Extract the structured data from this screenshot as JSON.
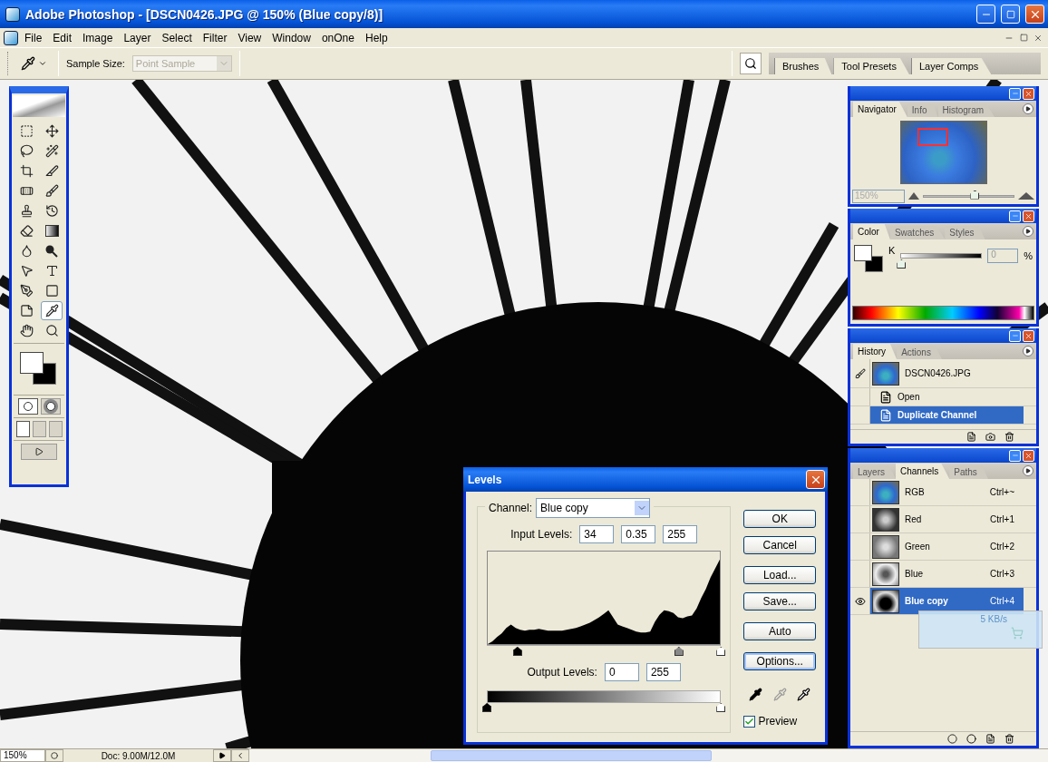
{
  "window": {
    "title": "Adobe Photoshop - [DSCN0426.JPG @ 150% (Blue copy/8)]"
  },
  "menu": [
    "File",
    "Edit",
    "Image",
    "Layer",
    "Select",
    "Filter",
    "View",
    "Window",
    "onOne",
    "Help"
  ],
  "options_bar": {
    "sample_size_label": "Sample Size:",
    "sample_size": {
      "value": "Point Sample",
      "disabled": true
    }
  },
  "palette_well_tabs": [
    "Brushes",
    "Tool Presets",
    "Layer Comps"
  ],
  "toolbox": {
    "tools": [
      {
        "kind": "marquee",
        "selected": false
      },
      {
        "kind": "move",
        "selected": false
      },
      {
        "kind": "lasso",
        "selected": false
      },
      {
        "kind": "wand",
        "selected": false
      },
      {
        "kind": "crop",
        "selected": false
      },
      {
        "kind": "slice",
        "selected": false
      },
      {
        "kind": "healing",
        "selected": false
      },
      {
        "kind": "brush",
        "selected": false
      },
      {
        "kind": "stamp",
        "selected": false
      },
      {
        "kind": "history",
        "selected": false
      },
      {
        "kind": "eraser",
        "selected": false
      },
      {
        "kind": "gradient",
        "selected": false
      },
      {
        "kind": "blur",
        "selected": false
      },
      {
        "kind": "dodge",
        "selected": false
      },
      {
        "kind": "path",
        "selected": false
      },
      {
        "kind": "type",
        "selected": false
      },
      {
        "kind": "pen",
        "selected": false
      },
      {
        "kind": "shape",
        "selected": false
      },
      {
        "kind": "notes",
        "selected": false
      },
      {
        "kind": "eyedropper",
        "selected": true
      },
      {
        "kind": "hand",
        "selected": false
      },
      {
        "kind": "zoom",
        "selected": false
      }
    ],
    "mask_modes": [
      {
        "selected": true
      },
      {
        "selected": false
      }
    ],
    "screen_modes": [
      {
        "selected": true
      },
      {
        "selected": false
      },
      {
        "selected": false
      }
    ]
  },
  "navigator": {
    "tabs": [
      {
        "label": "Navigator",
        "selected": true
      },
      {
        "label": "Info",
        "selected": false
      },
      {
        "label": "Histogram",
        "selected": false
      }
    ],
    "zoom": "150%",
    "zoom_slider": {
      "level": 0.57
    }
  },
  "color": {
    "tabs": [
      {
        "label": "Color",
        "selected": true
      },
      {
        "label": "Swatches",
        "selected": false
      },
      {
        "label": "Styles",
        "selected": false
      }
    ],
    "channel": "K",
    "slider": {
      "level": 0
    },
    "value": "0",
    "unit": "%"
  },
  "history": {
    "tabs": [
      {
        "label": "History",
        "selected": true
      },
      {
        "label": "Actions",
        "selected": false
      }
    ],
    "items": [
      {
        "kind": "snapshot",
        "label": "DSCN0426.JPG",
        "selected": false
      },
      {
        "kind": "step",
        "label": "Open",
        "selected": false
      },
      {
        "kind": "step",
        "label": "Duplicate Channel",
        "selected": true
      }
    ]
  },
  "channels": {
    "tabs": [
      {
        "label": "Layers",
        "selected": false
      },
      {
        "label": "Channels",
        "selected": true
      },
      {
        "label": "Paths",
        "selected": false
      }
    ],
    "rows": [
      {
        "name": "RGB",
        "shortcut": "Ctrl+~",
        "kind": "color",
        "visible": false,
        "selected": false
      },
      {
        "name": "Red",
        "shortcut": "Ctrl+1",
        "kind": "dark",
        "visible": false,
        "selected": false
      },
      {
        "name": "Green",
        "shortcut": "Ctrl+2",
        "kind": "mid",
        "visible": false,
        "selected": false
      },
      {
        "name": "Blue",
        "shortcut": "Ctrl+3",
        "kind": "light",
        "visible": false,
        "selected": false
      },
      {
        "name": "Blue copy",
        "shortcut": "Ctrl+4",
        "kind": "mask",
        "visible": true,
        "selected": true
      }
    ]
  },
  "download_overlay": {
    "speed": "5 KB/s"
  },
  "levels_dialog": {
    "title": "Levels",
    "channel_label": "Channel:",
    "channel": "Blue copy",
    "input_label": "Input Levels:",
    "input_values": [
      "34",
      "0.35",
      "255"
    ],
    "input_sliders": [
      {
        "level": 0.13
      },
      {
        "level": 0.82
      },
      {
        "level": 1
      }
    ],
    "output_label": "Output Levels:",
    "output_values": [
      "0",
      "255"
    ],
    "output_sliders": [
      {
        "level": 0
      },
      {
        "level": 1
      }
    ],
    "buttons": [
      {
        "label": "OK",
        "default": false
      },
      {
        "label": "Cancel",
        "default": false
      },
      {
        "label": "Load...",
        "default": false
      },
      {
        "label": "Save...",
        "default": false
      },
      {
        "label": "Auto",
        "default": false
      },
      {
        "label": "Options...",
        "default": true
      }
    ],
    "preview": {
      "label": "Preview",
      "checked": true
    }
  },
  "status_bar": {
    "zoom": "150%",
    "doc": "Doc: 9.00M/12.0M"
  }
}
